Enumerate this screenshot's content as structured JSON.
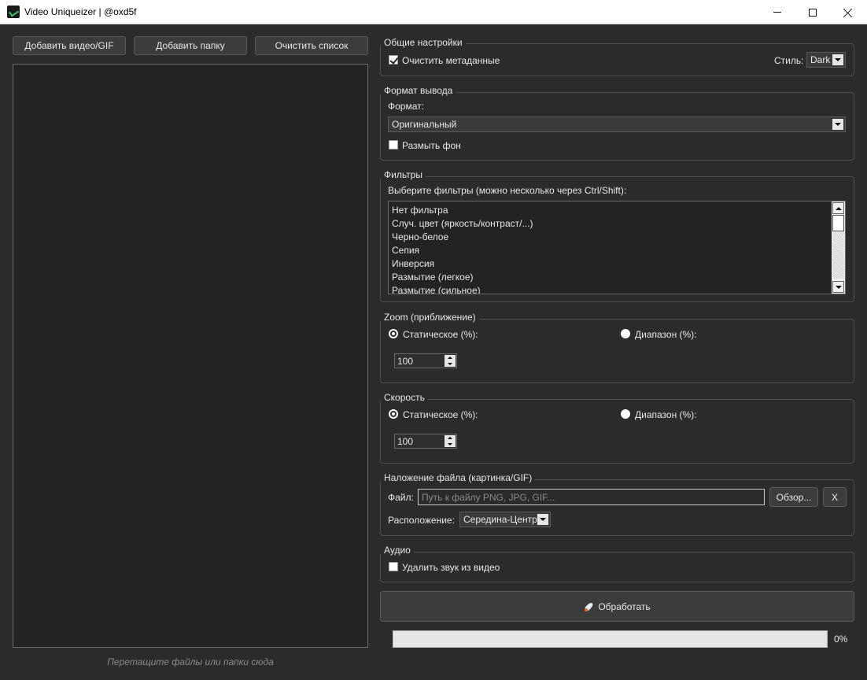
{
  "window": {
    "title": "Video Uniqueizer | @oxd5f",
    "controls": {
      "minimize": "minimize",
      "maximize": "maximize",
      "close": "close"
    }
  },
  "toolbar": {
    "add_video_label": "Добавить видео/GIF",
    "add_folder_label": "Добавить папку",
    "clear_list_label": "Очистить список"
  },
  "filelist": {
    "drop_hint": "Перетащите файлы или папки сюда"
  },
  "general": {
    "title": "Общие настройки",
    "clear_metadata_label": "Очистить метаданные",
    "clear_metadata_checked": true,
    "style_label": "Стиль:",
    "style_value": "Dark"
  },
  "output_format": {
    "title": "Формат вывода",
    "format_label": "Формат:",
    "format_value": "Оригинальный",
    "blur_bg_label": "Размыть фон",
    "blur_bg_checked": false
  },
  "filters": {
    "title": "Фильтры",
    "hint": "Выберите фильтры (можно несколько через Ctrl/Shift):",
    "items": [
      "Нет фильтра",
      "Случ. цвет (яркость/контраст/...)",
      "Черно-белое",
      "Сепия",
      "Инверсия",
      "Размытие (легкое)",
      "Размытие (сильное)"
    ]
  },
  "zoom": {
    "title": "Zoom (приближение)",
    "static_label": "Статическое (%):",
    "range_label": "Диапазон (%):",
    "selected": "static",
    "value": "100"
  },
  "speed": {
    "title": "Скорость",
    "static_label": "Статическое (%):",
    "range_label": "Диапазон (%):",
    "selected": "static",
    "value": "100"
  },
  "overlay": {
    "title": "Наложение файла (картинка/GIF)",
    "file_label": "Файл:",
    "file_placeholder": "Путь к файлу PNG, JPG, GIF...",
    "browse_label": "Обзор...",
    "clear_label": "X",
    "position_label": "Расположение:",
    "position_value": "Середина-Центр"
  },
  "audio": {
    "title": "Аудио",
    "remove_audio_label": "Удалить звук из видео",
    "remove_audio_checked": false
  },
  "process": {
    "label": "Обработать",
    "icon": "rocket-icon"
  },
  "progress": {
    "value": 0,
    "label": "0%"
  }
}
